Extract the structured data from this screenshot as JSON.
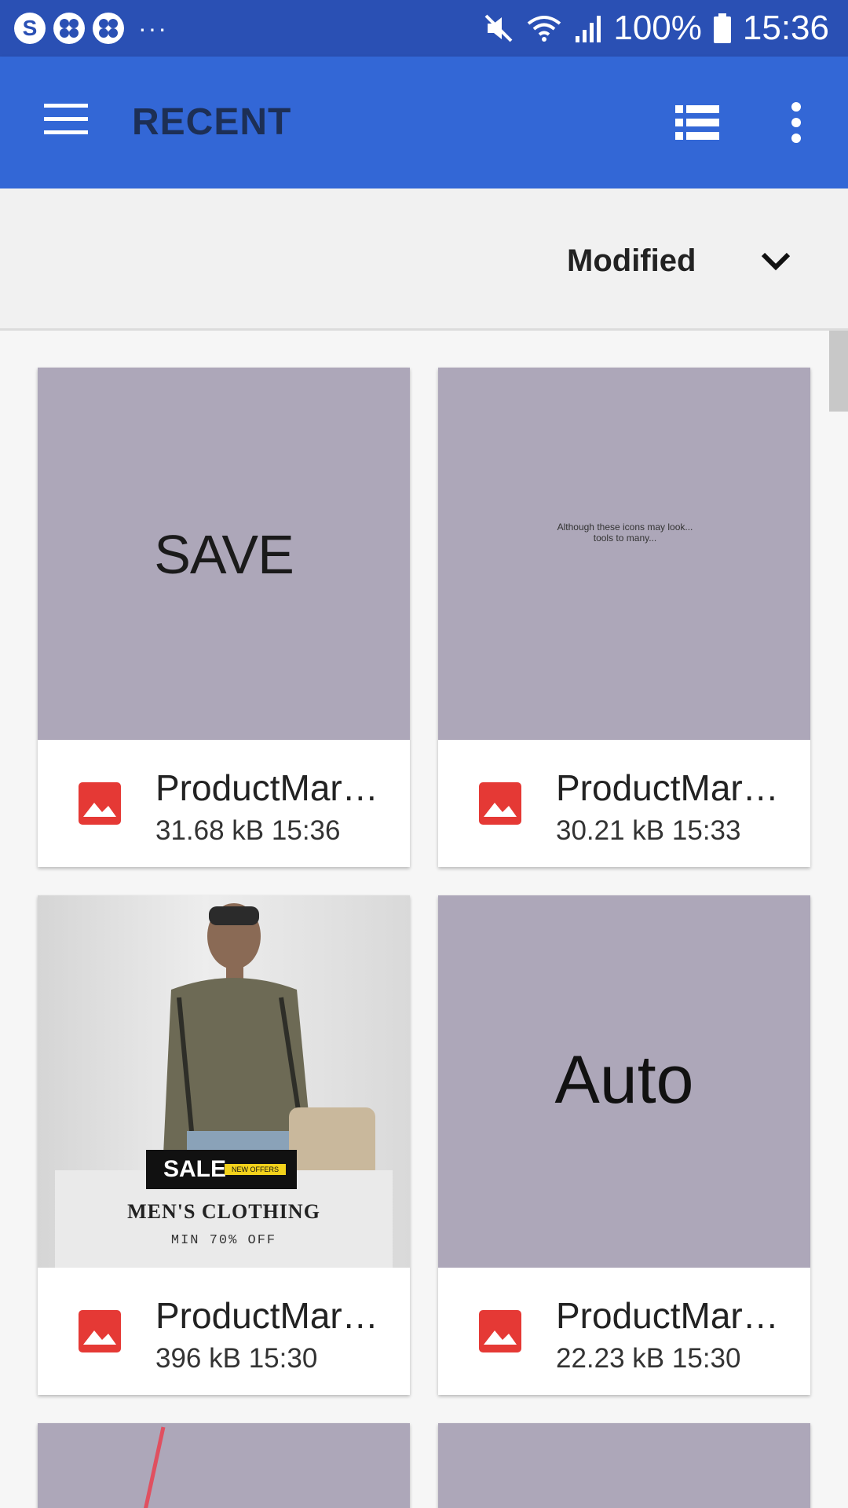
{
  "status_bar": {
    "battery": "100%",
    "time": "15:36",
    "dots": "···",
    "skype_letter": "S"
  },
  "app_bar": {
    "title": "RECENT"
  },
  "sort": {
    "label": "Modified"
  },
  "files": [
    {
      "name": "ProductMar…",
      "size": "31.68 kB",
      "time": "15:36",
      "thumb_text": "SAVE"
    },
    {
      "name": "ProductMar…",
      "size": "30.21 kB",
      "time": "15:33",
      "thumb_text": "Although these icons may look... tools to many..."
    },
    {
      "name": "ProductMar…",
      "size": "396 kB",
      "time": "15:30",
      "thumb_sale": "SALE",
      "thumb_tag": "NEW OFFERS",
      "thumb_heading": "MEN'S CLOTHING",
      "thumb_sub": "MIN 70% OFF"
    },
    {
      "name": "ProductMar…",
      "size": "22.23 kB",
      "time": "15:30",
      "thumb_text": "Auto"
    }
  ],
  "colors": {
    "status_bar": "#2a50b4",
    "app_bar": "#3367d6",
    "thumb_bg": "#ada7b9",
    "image_icon": "#e53935"
  },
  "icons": [
    "skype-icon",
    "clover-icon",
    "mute-icon",
    "wifi-icon",
    "signal-icon",
    "battery-icon",
    "menu-icon",
    "list-view-icon",
    "more-icon",
    "chevron-down-icon",
    "image-icon"
  ]
}
